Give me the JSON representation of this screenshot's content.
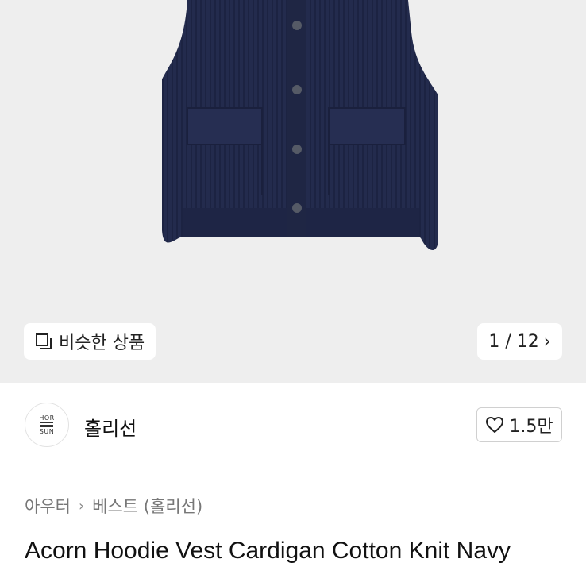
{
  "image_viewer": {
    "similar_label": "비슷한 상품",
    "counter": "1 / 12",
    "chevron": "›"
  },
  "store": {
    "logo_line1": "HOR",
    "logo_line2": "SUN",
    "name": "홀리선",
    "likes": "1.5만"
  },
  "breadcrumb": {
    "items": [
      "아우터",
      "베스트 (홀리선)"
    ],
    "separator": "›"
  },
  "product": {
    "title": "Acorn Hoodie Vest Cardigan Cotton Knit Navy"
  },
  "colors": {
    "hero_bg": "#eeeeee",
    "garment": "#232b4d"
  },
  "icons": [
    "square-stack-icon",
    "chevron-right-icon",
    "heart-icon"
  ]
}
